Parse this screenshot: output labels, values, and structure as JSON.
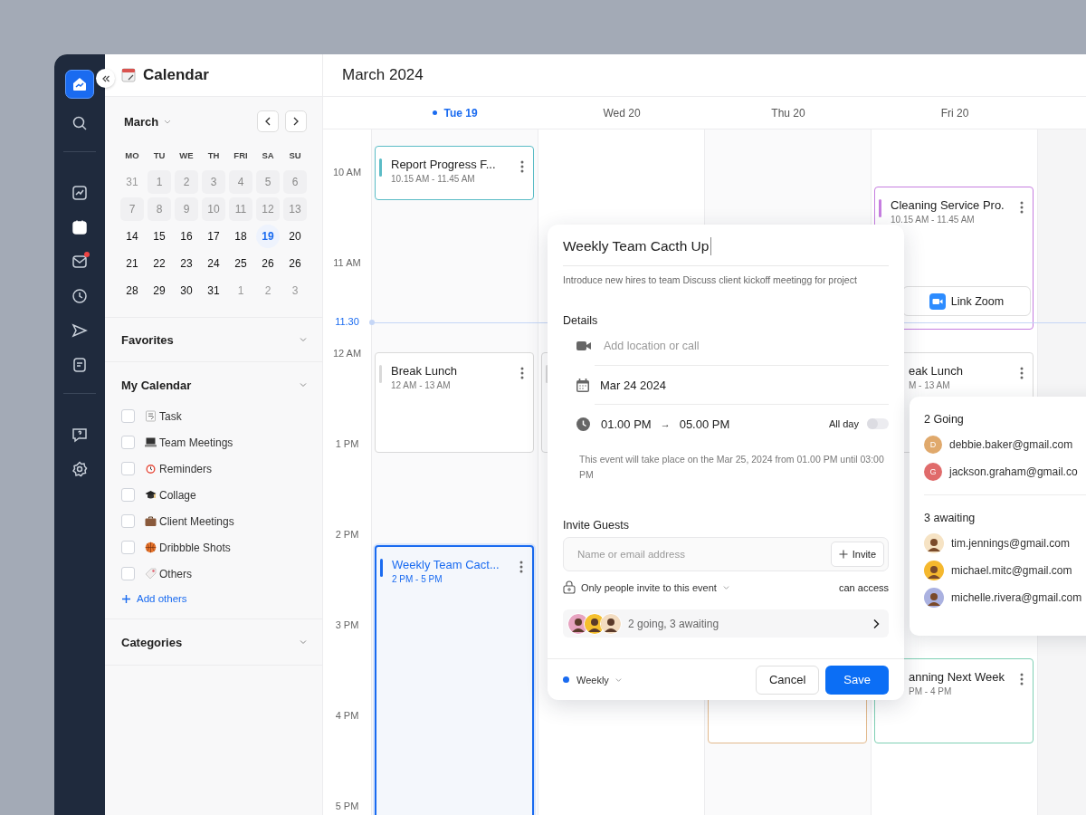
{
  "rail": {
    "items": [
      {
        "selected": false,
        "notification": false
      },
      {
        "selected": false,
        "notification": false
      },
      {
        "selected": true,
        "notification": false
      },
      {
        "selected": false,
        "notification": true
      },
      {
        "selected": false,
        "notification": false
      },
      {
        "selected": false,
        "notification": false
      },
      {
        "selected": false,
        "notification": false
      },
      {
        "selected": false,
        "notification": false
      },
      {
        "selected": false,
        "notification": false
      }
    ]
  },
  "left_panel": {
    "title": "Calendar",
    "month": "March",
    "weekdays": [
      "MO",
      "TU",
      "WE",
      "TH",
      "FRI",
      "SA",
      "SU"
    ],
    "days": [
      {
        "label": "31",
        "kind": "outside",
        "selected": false
      },
      {
        "label": "1",
        "kind": "past",
        "selected": false
      },
      {
        "label": "2",
        "kind": "past",
        "selected": false
      },
      {
        "label": "3",
        "kind": "past",
        "selected": false
      },
      {
        "label": "4",
        "kind": "past",
        "selected": false
      },
      {
        "label": "5",
        "kind": "past",
        "selected": false
      },
      {
        "label": "6",
        "kind": "past",
        "selected": false
      },
      {
        "label": "7",
        "kind": "past",
        "selected": false
      },
      {
        "label": "8",
        "kind": "past",
        "selected": false
      },
      {
        "label": "9",
        "kind": "past",
        "selected": false
      },
      {
        "label": "10",
        "kind": "past",
        "selected": false
      },
      {
        "label": "11",
        "kind": "past",
        "selected": false
      },
      {
        "label": "12",
        "kind": "past",
        "selected": false
      },
      {
        "label": "13",
        "kind": "past",
        "selected": false
      },
      {
        "label": "14",
        "kind": "current",
        "selected": false
      },
      {
        "label": "15",
        "kind": "current",
        "selected": false
      },
      {
        "label": "16",
        "kind": "current",
        "selected": false
      },
      {
        "label": "17",
        "kind": "current",
        "selected": false
      },
      {
        "label": "18",
        "kind": "current",
        "selected": false
      },
      {
        "label": "19",
        "kind": "current",
        "selected": true
      },
      {
        "label": "20",
        "kind": "current",
        "selected": false
      },
      {
        "label": "21",
        "kind": "current",
        "selected": false
      },
      {
        "label": "22",
        "kind": "current",
        "selected": false
      },
      {
        "label": "23",
        "kind": "current",
        "selected": false
      },
      {
        "label": "24",
        "kind": "current",
        "selected": false
      },
      {
        "label": "25",
        "kind": "current",
        "selected": false
      },
      {
        "label": "26",
        "kind": "current",
        "selected": false
      },
      {
        "label": "26",
        "kind": "current",
        "selected": false
      },
      {
        "label": "28",
        "kind": "current",
        "selected": false
      },
      {
        "label": "29",
        "kind": "current",
        "selected": false
      },
      {
        "label": "30",
        "kind": "current",
        "selected": false
      },
      {
        "label": "31",
        "kind": "current",
        "selected": false
      },
      {
        "label": "1",
        "kind": "outside",
        "selected": false
      },
      {
        "label": "2",
        "kind": "outside",
        "selected": false
      },
      {
        "label": "3",
        "kind": "outside",
        "selected": false
      }
    ],
    "favorites": "Favorites",
    "my_calendar": {
      "title": "My Calendar",
      "items": [
        {
          "label": "Task",
          "checked": false
        },
        {
          "label": "Team Meetings",
          "checked": false
        },
        {
          "label": "Reminders",
          "checked": false
        },
        {
          "label": "Collage",
          "checked": false
        },
        {
          "label": "Client Meetings",
          "checked": false
        },
        {
          "label": "Dribbble Shots",
          "checked": false
        },
        {
          "label": "Others",
          "checked": false
        }
      ],
      "add_label": "Add others"
    },
    "categories": "Categories"
  },
  "main": {
    "title": "March 2024",
    "times": [
      "10 AM",
      "11 AM",
      "12 AM",
      "1 PM",
      "2 PM",
      "3 PM",
      "4 PM",
      "5 PM"
    ],
    "now_label": "11.30",
    "days": [
      {
        "label": "Tue 19",
        "selected": true,
        "events": [
          {
            "title": "Report Progress F...",
            "time": "10.15 AM - 11.45 AM",
            "color": "#5bbcc6",
            "selected": false
          },
          {
            "title": "Break Lunch",
            "time": "12 AM - 13 AM",
            "color": "#d9d9d9",
            "selected": false
          },
          {
            "title": "Weekly Team Cact...",
            "time": "2 PM - 5 PM",
            "color": "#1a6bf0",
            "selected": true
          }
        ]
      },
      {
        "label": "Wed 20",
        "selected": false,
        "events": [
          {
            "color": "#d9d9d9",
            "selected": false
          }
        ]
      },
      {
        "label": "Thu 20",
        "selected": false,
        "events": [
          {
            "color": "#e2b98c",
            "selected": false
          }
        ]
      },
      {
        "label": "Fri 20",
        "selected": false,
        "events": [
          {
            "title": "Cleaning Service Pro.",
            "time": "10.15 AM - 11.45 AM",
            "color": "#c67ee0",
            "selected": false,
            "link": "Link Zoom"
          },
          {
            "title": "eak Lunch",
            "time": "M - 13 AM",
            "color": "#d9d9d9",
            "selected": false,
            "cut_left": true
          },
          {
            "title": "anning Next Week",
            "time": "PM - 4 PM",
            "color": "#7fd0b4",
            "selected": false,
            "cut_left": true
          }
        ]
      }
    ]
  },
  "popup": {
    "title": "Weekly Team Cacth Up",
    "description": "Introduce new hires to team Discuss client kickoff meetingg for project",
    "details_label": "Details",
    "location_placeholder": "Add location or call",
    "date": "Mar 24 2024",
    "start": "01.00 PM",
    "arrow": "→",
    "end": "05.00 PM",
    "all_day_label": "All day",
    "all_day": false,
    "note": "This event will take place on the Mar 25, 2024 from 01.00 PM until 03:00 PM",
    "invite_label": "Invite Guests",
    "invite_placeholder": "Name or email address",
    "invite_button": "Invite",
    "access": "Only people invite to this event",
    "access_right": "can access",
    "guests_summary": "2 going, 3 awaiting",
    "repeat": "Weekly",
    "cancel": "Cancel",
    "save": "Save"
  },
  "guests": {
    "going_label": "2 Going",
    "going": [
      {
        "initial": "D",
        "email": "debbie.baker@gmail.com",
        "color": "#e0a96c"
      },
      {
        "initial": "G",
        "email": "jackson.graham@gmail.co",
        "color": "#e06b6b"
      }
    ],
    "awaiting_label": "3 awaiting",
    "awaiting": [
      {
        "email": "tim.jennings@gmail.com",
        "color": "#f6e3c4"
      },
      {
        "email": "michael.mitc@gmail.com",
        "color": "#f5b82e"
      },
      {
        "email": "michelle.rivera@gmail.com",
        "color": "#aab1e0"
      }
    ]
  }
}
